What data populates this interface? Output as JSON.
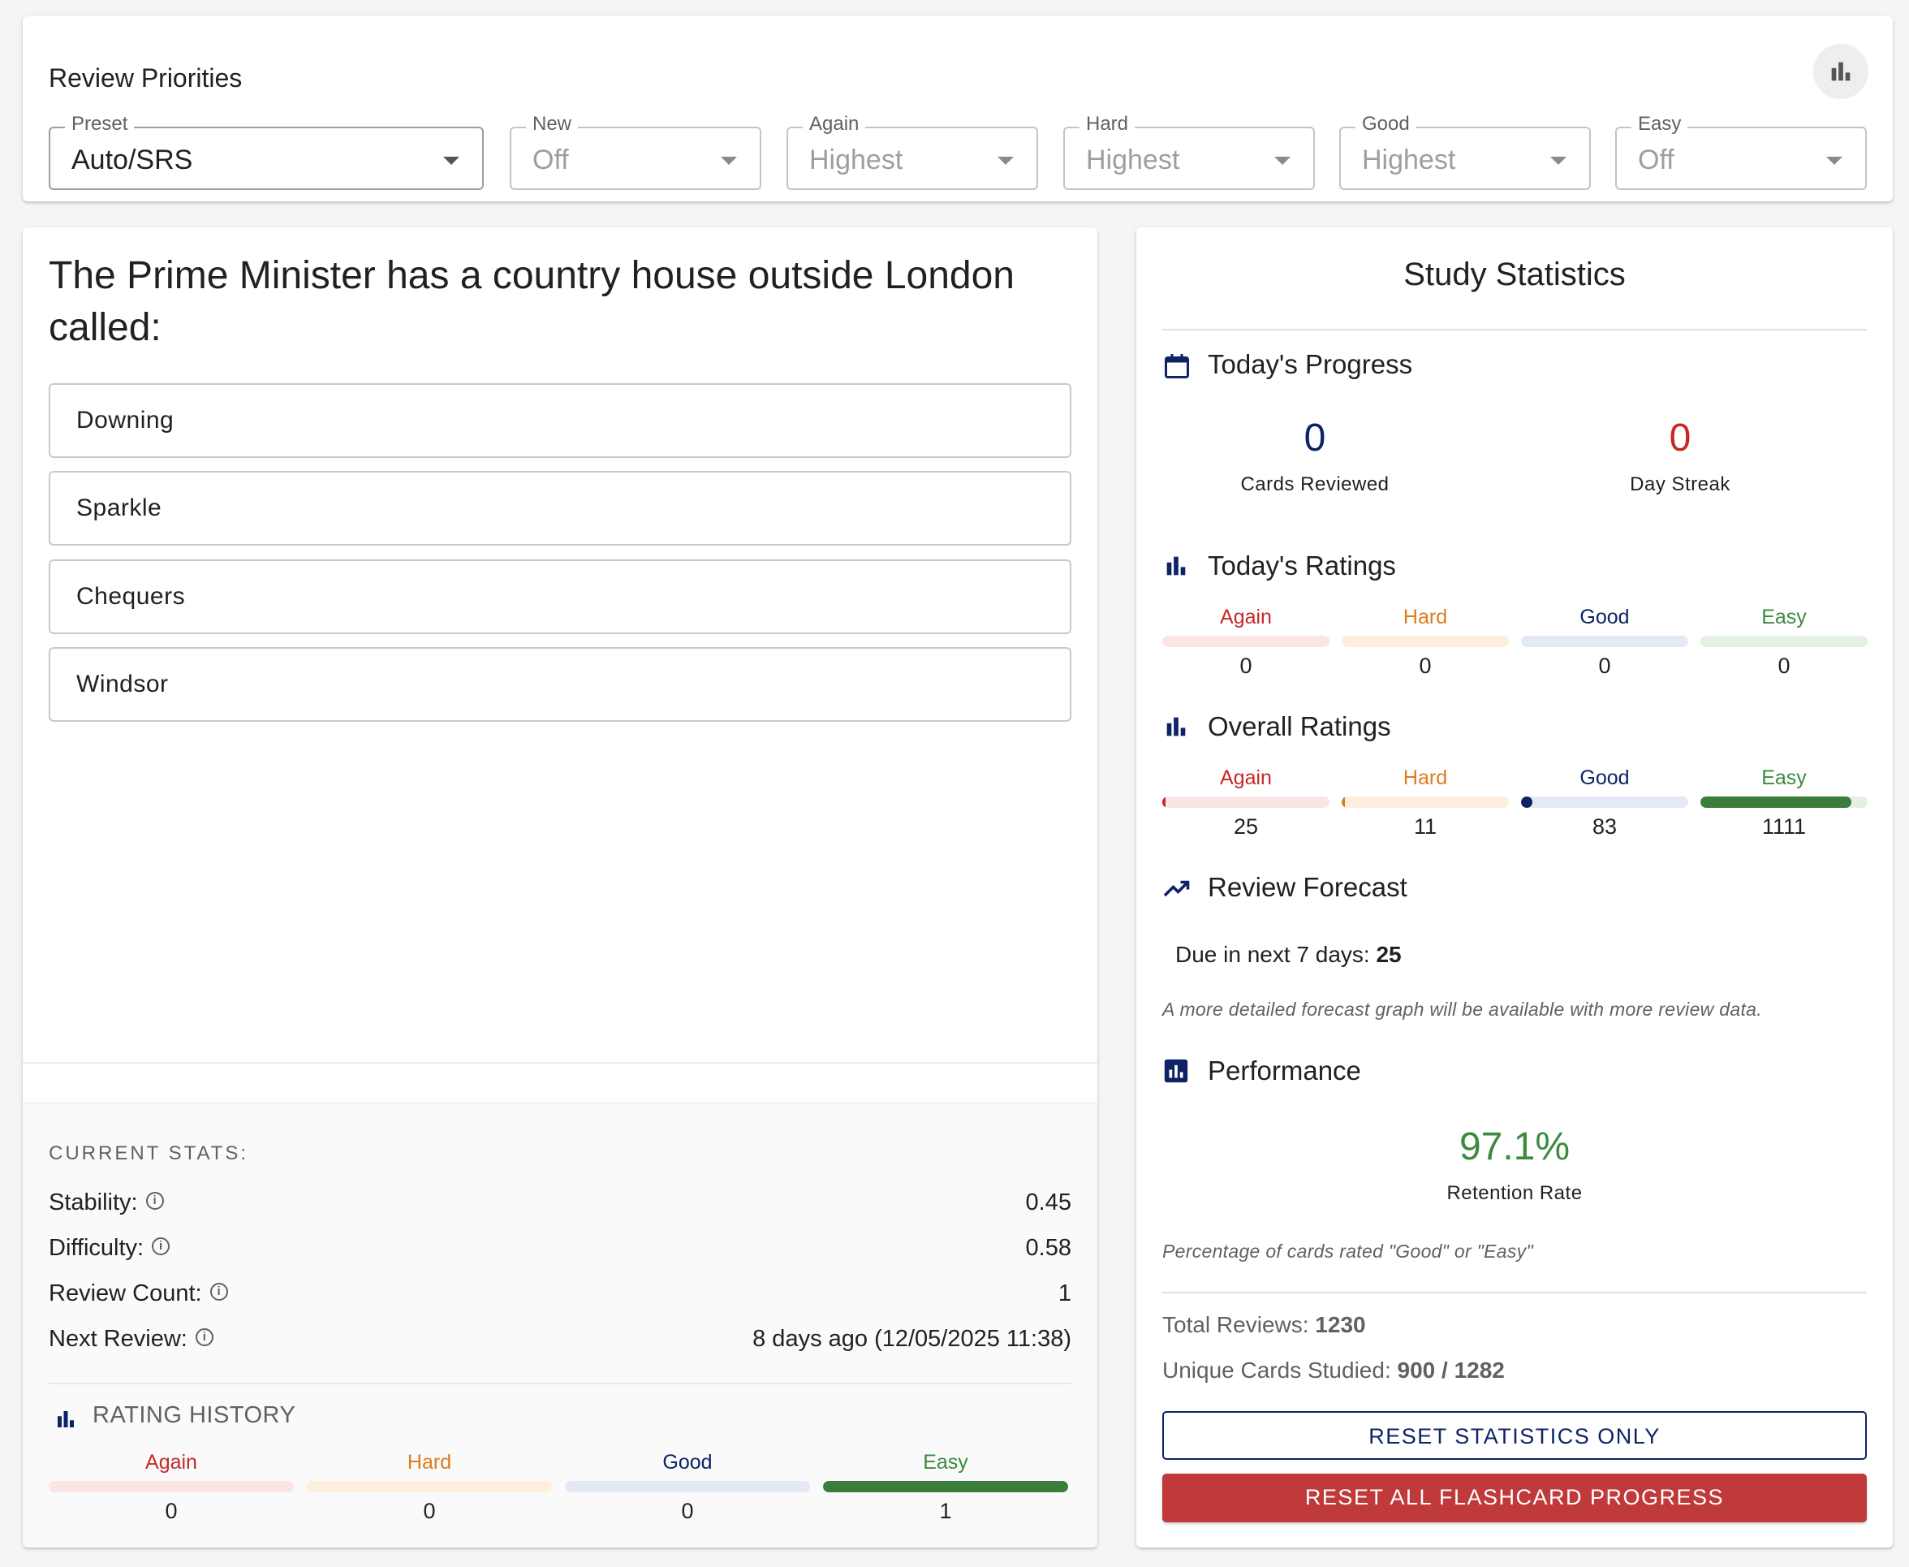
{
  "priorities": {
    "title": "Review Priorities",
    "filters": [
      {
        "label": "Preset",
        "value": "Auto/SRS"
      },
      {
        "label": "New",
        "value": "Off"
      },
      {
        "label": "Again",
        "value": "Highest"
      },
      {
        "label": "Hard",
        "value": "Highest"
      },
      {
        "label": "Good",
        "value": "Highest"
      },
      {
        "label": "Easy",
        "value": "Off"
      }
    ]
  },
  "question": {
    "text": "The Prime Minister has a country house outside London called:",
    "options": [
      "Downing",
      "Sparkle",
      "Chequers",
      "Windsor"
    ]
  },
  "current_stats": {
    "title": "CURRENT STATS:",
    "info_glyph": "i",
    "rows": [
      {
        "label": "Stability:",
        "value": "0.45"
      },
      {
        "label": "Difficulty:",
        "value": "0.58"
      },
      {
        "label": "Review Count:",
        "value": "1"
      },
      {
        "label": "Next Review:",
        "value": "8 days ago (12/05/2025 11:38)"
      }
    ],
    "rating_history": {
      "title": "RATING HISTORY",
      "items": [
        {
          "name": "Again",
          "count": "0",
          "fill": 0
        },
        {
          "name": "Hard",
          "count": "0",
          "fill": 0
        },
        {
          "name": "Good",
          "count": "0",
          "fill": 0
        },
        {
          "name": "Easy",
          "count": "1",
          "fill": 1
        }
      ]
    }
  },
  "study": {
    "title": "Study Statistics",
    "today_progress": {
      "title": "Today's Progress",
      "cards_reviewed": "0",
      "cards_reviewed_label": "Cards Reviewed",
      "day_streak": "0",
      "day_streak_label": "Day Streak"
    },
    "today_ratings": {
      "title": "Today's Ratings",
      "items": [
        {
          "name": "Again",
          "count": "0",
          "fill": 0
        },
        {
          "name": "Hard",
          "count": "0",
          "fill": 0
        },
        {
          "name": "Good",
          "count": "0",
          "fill": 0
        },
        {
          "name": "Easy",
          "count": "0",
          "fill": 0
        }
      ]
    },
    "overall_ratings": {
      "title": "Overall Ratings",
      "items": [
        {
          "name": "Again",
          "count": "25",
          "fill": 0.0203
        },
        {
          "name": "Hard",
          "count": "11",
          "fill": 0.0089
        },
        {
          "name": "Good",
          "count": "83",
          "fill": 0.0675
        },
        {
          "name": "Easy",
          "count": "1111",
          "fill": 0.9033
        }
      ]
    },
    "forecast": {
      "title": "Review Forecast",
      "due_label": "Due in next 7 days:",
      "due_value": "25",
      "note": "A more detailed forecast graph will be available with more review data."
    },
    "performance": {
      "title": "Performance",
      "retention": "97.1%",
      "retention_label": "Retention Rate",
      "note": "Percentage of cards rated \"Good\" or \"Easy\""
    },
    "total_reviews_label": "Total Reviews:",
    "total_reviews": "1230",
    "unique_label": "Unique Cards Studied:",
    "unique_value": "900 / 1282",
    "reset_stats_label": "RESET STATISTICS ONLY",
    "reset_all_label": "RESET ALL FLASHCARD PROGRESS"
  },
  "colors": {
    "again": "#c62828",
    "hard": "#e07b1f",
    "good": "#0d2366",
    "easy": "#3c8a3e",
    "primary": "#0d2366",
    "danger": "#c0393b"
  }
}
